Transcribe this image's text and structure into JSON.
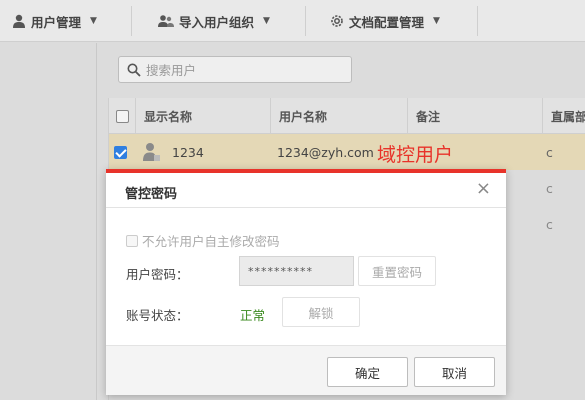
{
  "toolbar": {
    "user_mgmt": "用户管理",
    "import_org": "导入用户组织",
    "doc_config": "文档配置管理"
  },
  "search": {
    "placeholder": "搜索用户"
  },
  "grid": {
    "columns": [
      "显示名称",
      "用户名称",
      "备注",
      "直属部门"
    ],
    "rows": [
      {
        "display_name": "1234",
        "username": "1234@zyh.com",
        "remark": "",
        "dept": "c",
        "checked": true
      },
      {
        "display_name": "",
        "username": "",
        "remark": "",
        "dept": "c",
        "checked": false
      },
      {
        "display_name": "",
        "username": "",
        "remark": "",
        "dept": "c",
        "checked": false
      }
    ]
  },
  "annotation": "域控用户",
  "dialog": {
    "title": "管控密码",
    "close_glyph": "×",
    "disallow_label": "不允许用户自主修改密码",
    "password_label": "用户密码：",
    "password_value": "**********",
    "reset_label": "重置密码",
    "status_label": "账号状态：",
    "status_value": "正常",
    "unlock_label": "解锁",
    "ok_label": "确定",
    "cancel_label": "取消"
  },
  "colors": {
    "accent_red": "#e8332a",
    "status_green": "#3a8a1e",
    "checkbox_blue": "#2f7fe0"
  }
}
